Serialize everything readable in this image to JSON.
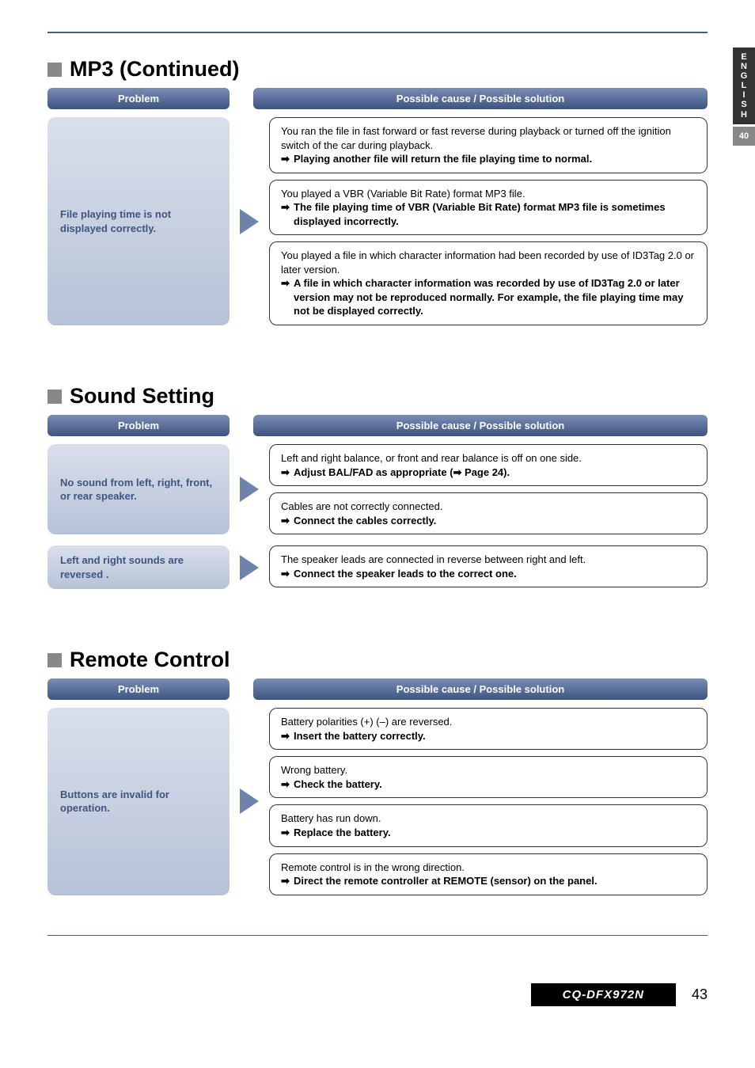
{
  "sideTab": {
    "lang": "ENGLISH",
    "num": "40"
  },
  "sections": [
    {
      "title": "MP3 (Continued)",
      "headers": {
        "problem": "Problem",
        "solution": "Possible cause / Possible solution"
      },
      "rows": [
        {
          "problem": "File playing time is not displayed correctly.",
          "solutions": [
            {
              "cause": "You ran the file in fast forward or fast reverse during playback or turned off the ignition switch of the car during playback.",
              "fix": "Playing another file will return the file playing time to normal."
            },
            {
              "cause": "You played a VBR (Variable Bit Rate) format MP3 file.",
              "fix": "The file playing time of VBR (Variable Bit Rate) format MP3 file is sometimes displayed incorrectly."
            },
            {
              "cause": "You played a file in which character information had been recorded by use of ID3Tag 2.0 or later version.",
              "fix": "A file in which character information was recorded by use of ID3Tag 2.0 or later version may not be reproduced normally. For example, the file playing time may not be displayed correctly."
            }
          ]
        }
      ]
    },
    {
      "title": "Sound Setting",
      "headers": {
        "problem": "Problem",
        "solution": "Possible cause / Possible solution"
      },
      "rows": [
        {
          "problem": "No sound from left, right, front, or rear speaker.",
          "solutions": [
            {
              "cause": "Left and right balance, or front and rear balance is off on one side.",
              "fix": "Adjust BAL/FAD as appropriate (➡ Page 24)."
            },
            {
              "cause": "Cables are not correctly connected.",
              "fix": "Connect the cables correctly."
            }
          ]
        },
        {
          "problem": "Left and right sounds are reversed .",
          "solutions": [
            {
              "cause": "The speaker leads are connected in reverse between right and left.",
              "fix": "Connect the speaker leads to the correct one."
            }
          ]
        }
      ]
    },
    {
      "title": "Remote Control",
      "headers": {
        "problem": "Problem",
        "solution": "Possible cause / Possible solution"
      },
      "rows": [
        {
          "problem": "Buttons are invalid for operation.",
          "solutions": [
            {
              "cause": "Battery polarities (+) (–) are reversed.",
              "fix": "Insert the battery correctly."
            },
            {
              "cause": "Wrong battery.",
              "fix": "Check the battery."
            },
            {
              "cause": "Battery has run down.",
              "fix": "Replace the battery."
            },
            {
              "cause": "Remote control is in the wrong direction.",
              "fix": "Direct the remote controller at REMOTE (sensor) on the panel."
            }
          ]
        }
      ]
    }
  ],
  "footer": {
    "model": "CQ-DFX972N",
    "page": "43"
  }
}
